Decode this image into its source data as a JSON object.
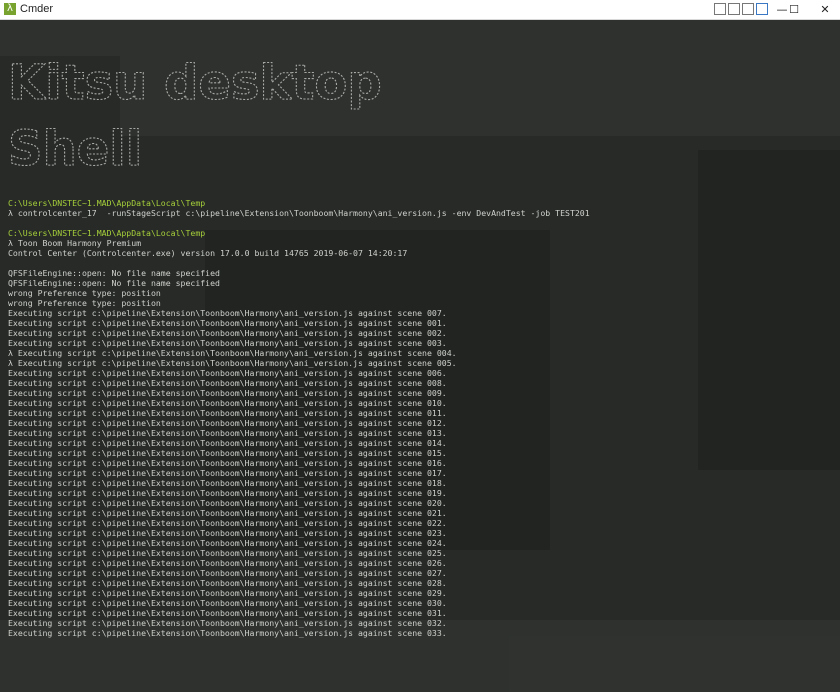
{
  "window": {
    "title": "Cmder",
    "controls": {
      "minimize": "—",
      "maximize": "☐",
      "close": "✕"
    }
  },
  "banner": {
    "line1": "Kitsu desktop",
    "line2": "Shell"
  },
  "terminal": {
    "block1": {
      "path": "C:\\Users\\DNSTEC~1.MAD\\AppData\\Local\\Temp",
      "command": "λ controlcenter_17  -runStageScript c:\\pipeline\\Extension\\Toonboom\\Harmony\\ani_version.js -env DevAndTest -job TEST201"
    },
    "block2": {
      "path": "C:\\Users\\DNSTEC~1.MAD\\AppData\\Local\\Temp",
      "lines": [
        "λ Toon Boom Harmony Premium",
        "Control Center (Controlcenter.exe) version 17.0.0 build 14765 2019-06-07 14:20:17"
      ]
    },
    "output": [
      "QFSFileEngine::open: No file name specified",
      "QFSFileEngine::open: No file name specified",
      "wrong Preference type: position",
      "wrong Preference type: position",
      "Executing script c:\\pipeline\\Extension\\Toonboom\\Harmony\\ani_version.js against scene 007.",
      "Executing script c:\\pipeline\\Extension\\Toonboom\\Harmony\\ani_version.js against scene 001.",
      "Executing script c:\\pipeline\\Extension\\Toonboom\\Harmony\\ani_version.js against scene 002.",
      "Executing script c:\\pipeline\\Extension\\Toonboom\\Harmony\\ani_version.js against scene 003.",
      "λ Executing script c:\\pipeline\\Extension\\Toonboom\\Harmony\\ani_version.js against scene 004.",
      "λ Executing script c:\\pipeline\\Extension\\Toonboom\\Harmony\\ani_version.js against scene 005.",
      "Executing script c:\\pipeline\\Extension\\Toonboom\\Harmony\\ani_version.js against scene 006.",
      "Executing script c:\\pipeline\\Extension\\Toonboom\\Harmony\\ani_version.js against scene 008.",
      "Executing script c:\\pipeline\\Extension\\Toonboom\\Harmony\\ani_version.js against scene 009.",
      "Executing script c:\\pipeline\\Extension\\Toonboom\\Harmony\\ani_version.js against scene 010.",
      "Executing script c:\\pipeline\\Extension\\Toonboom\\Harmony\\ani_version.js against scene 011.",
      "Executing script c:\\pipeline\\Extension\\Toonboom\\Harmony\\ani_version.js against scene 012.",
      "Executing script c:\\pipeline\\Extension\\Toonboom\\Harmony\\ani_version.js against scene 013.",
      "Executing script c:\\pipeline\\Extension\\Toonboom\\Harmony\\ani_version.js against scene 014.",
      "Executing script c:\\pipeline\\Extension\\Toonboom\\Harmony\\ani_version.js against scene 015.",
      "Executing script c:\\pipeline\\Extension\\Toonboom\\Harmony\\ani_version.js against scene 016.",
      "Executing script c:\\pipeline\\Extension\\Toonboom\\Harmony\\ani_version.js against scene 017.",
      "Executing script c:\\pipeline\\Extension\\Toonboom\\Harmony\\ani_version.js against scene 018.",
      "Executing script c:\\pipeline\\Extension\\Toonboom\\Harmony\\ani_version.js against scene 019.",
      "Executing script c:\\pipeline\\Extension\\Toonboom\\Harmony\\ani_version.js against scene 020.",
      "Executing script c:\\pipeline\\Extension\\Toonboom\\Harmony\\ani_version.js against scene 021.",
      "Executing script c:\\pipeline\\Extension\\Toonboom\\Harmony\\ani_version.js against scene 022.",
      "Executing script c:\\pipeline\\Extension\\Toonboom\\Harmony\\ani_version.js against scene 023.",
      "Executing script c:\\pipeline\\Extension\\Toonboom\\Harmony\\ani_version.js against scene 024.",
      "Executing script c:\\pipeline\\Extension\\Toonboom\\Harmony\\ani_version.js against scene 025.",
      "Executing script c:\\pipeline\\Extension\\Toonboom\\Harmony\\ani_version.js against scene 026.",
      "Executing script c:\\pipeline\\Extension\\Toonboom\\Harmony\\ani_version.js against scene 027.",
      "Executing script c:\\pipeline\\Extension\\Toonboom\\Harmony\\ani_version.js against scene 028.",
      "Executing script c:\\pipeline\\Extension\\Toonboom\\Harmony\\ani_version.js against scene 029.",
      "Executing script c:\\pipeline\\Extension\\Toonboom\\Harmony\\ani_version.js against scene 030.",
      "Executing script c:\\pipeline\\Extension\\Toonboom\\Harmony\\ani_version.js against scene 031.",
      "Executing script c:\\pipeline\\Extension\\Toonboom\\Harmony\\ani_version.js against scene 032.",
      "Executing script c:\\pipeline\\Extension\\Toonboom\\Harmony\\ani_version.js against scene 033."
    ]
  },
  "colors": {
    "background": "#272a27",
    "text": "#cfd2cc",
    "path": "#a6cf3a",
    "app_icon": "#78a32f"
  }
}
